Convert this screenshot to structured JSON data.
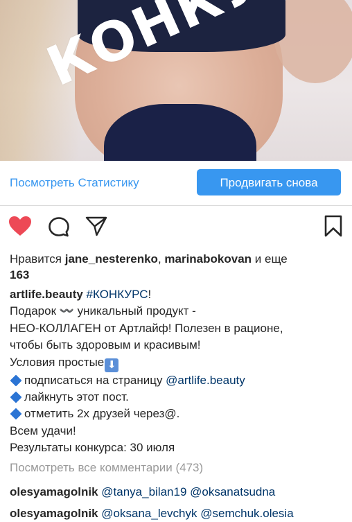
{
  "post": {
    "image_overlay_text": "КОНКУРС"
  },
  "promo": {
    "stats_link": "Посмотреть Статистику",
    "promote_button": "Продвигать снова"
  },
  "likes": {
    "prefix": "Нравится ",
    "user1": "jane_nesterenko",
    "sep": ", ",
    "user2": "marinabokovan",
    "suffix": " и еще",
    "count": "163"
  },
  "caption": {
    "username": "artlife.beauty",
    "hashtag": "#КОНКУРС",
    "hashtag_after": "!",
    "line1": "Подарок 〰️ уникальный продукт -",
    "line2": "НЕО-КОЛЛАГЕН от Артлайф! Полезен в рационе,",
    "line3": "чтобы быть здоровым и красивым!",
    "line4": "Условия простые",
    "line4_emoji": "⬇",
    "bullet1_text": "подписаться на страницу ",
    "bullet1_mention": "@artlife.beauty",
    "bullet2_text": "лайкнуть этот пост.",
    "bullet3_text": "отметить 2х друзей через@.",
    "line8": "Всем удачи!",
    "line9": "Результаты конкурса: 30 июля"
  },
  "view_all_comments": "Посмотреть все комментарии (473)",
  "comments": [
    {
      "username": "olesyamagolnik",
      "mentions": "@tanya_bilan19 @oksanatsudna"
    },
    {
      "username": "olesyamagolnik",
      "mentions": "@oksana_levchyk @semchuk.olesia"
    }
  ],
  "icons": {
    "like": "heart-filled-icon",
    "comment": "comment-bubble-icon",
    "share": "direct-share-icon",
    "save": "bookmark-icon"
  },
  "colors": {
    "accent_blue": "#3897f0",
    "like_red": "#ed4956",
    "mention_blue": "#003569",
    "muted_gray": "#999999",
    "text": "#262626"
  }
}
